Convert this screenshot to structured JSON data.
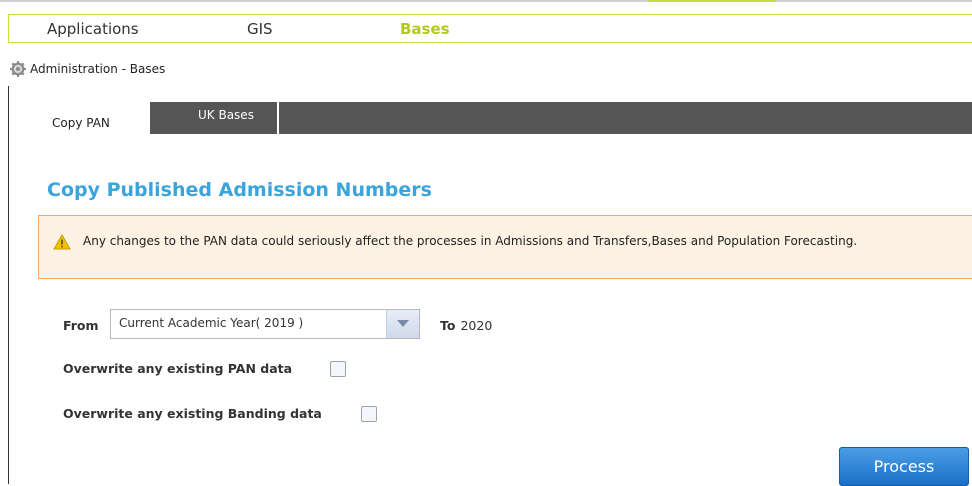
{
  "topnav": {
    "items": [
      {
        "label": "Applications",
        "active": false
      },
      {
        "label": "GIS",
        "active": false
      },
      {
        "label": "Bases",
        "active": true
      }
    ]
  },
  "breadcrumb": {
    "icon": "gear-icon",
    "text": "Administration - Bases"
  },
  "tabs": [
    {
      "label": "Copy PAN",
      "active": true
    },
    {
      "label": "UK Bases",
      "active": false
    }
  ],
  "heading": "Copy Published Admission Numbers",
  "warning": {
    "icon": "warning-icon",
    "text": "Any changes to the PAN data could seriously affect the processes in Admissions and Transfers,Bases and Population Forecasting."
  },
  "form": {
    "from_label": "From",
    "from_value": "Current Academic Year( 2019 )",
    "to_label": "To",
    "to_value": "2020",
    "overwrite_pan_label": "Overwrite any existing PAN data",
    "overwrite_pan_checked": false,
    "overwrite_banding_label": "Overwrite any existing Banding data",
    "overwrite_banding_checked": false
  },
  "process_button": "Process",
  "colors": {
    "accent_nav": "#b4c81e",
    "heading": "#3aa4dc",
    "warning_border": "#f2a46a",
    "button": "#1b6fc8"
  }
}
